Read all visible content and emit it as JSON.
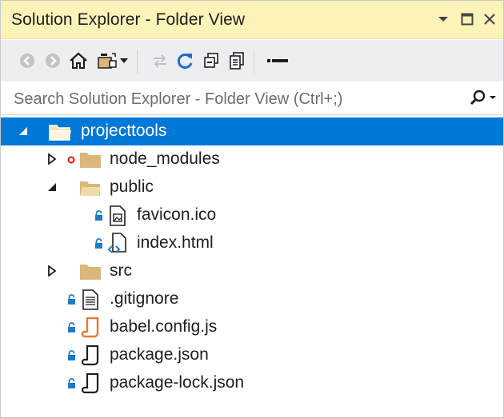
{
  "window": {
    "title": "Solution Explorer - Folder View"
  },
  "title_controls": [
    {
      "name": "window-position-dropdown",
      "icon": "chevron-down-icon"
    },
    {
      "name": "maximize-button",
      "icon": "maximize-icon"
    },
    {
      "name": "close-button",
      "icon": "close-icon"
    }
  ],
  "toolbar": {
    "buttons": [
      {
        "name": "back-button",
        "icon": "back-arrow-icon"
      },
      {
        "name": "forward-button",
        "icon": "forward-arrow-icon"
      },
      {
        "name": "home-button",
        "icon": "home-icon"
      },
      {
        "name": "switch-views-button",
        "icon": "switch-views-icon"
      },
      {
        "name": "switch-views-dropdown",
        "icon": "chevron-down-icon"
      },
      {
        "name": "sync-button",
        "icon": "sync-icon"
      },
      {
        "name": "refresh-button",
        "icon": "refresh-icon"
      },
      {
        "name": "collapse-all-button",
        "icon": "collapse-all-icon"
      },
      {
        "name": "show-all-files-button",
        "icon": "show-all-files-icon"
      },
      {
        "name": "properties-button",
        "icon": "properties-icon"
      }
    ]
  },
  "search": {
    "placeholder": "Search Solution Explorer - Folder View (Ctrl+;)"
  },
  "tree": {
    "items": [
      {
        "label": "projecttools",
        "type": "folder-open",
        "expanded": true,
        "selected": true
      },
      {
        "label": "node_modules",
        "type": "folder",
        "expanded": false,
        "status": "excluded"
      },
      {
        "label": "public",
        "type": "folder-open",
        "expanded": true
      },
      {
        "label": "favicon.ico",
        "type": "image-file",
        "status": "locked"
      },
      {
        "label": "index.html",
        "type": "html-file",
        "status": "locked"
      },
      {
        "label": "src",
        "type": "folder",
        "expanded": false
      },
      {
        "label": ".gitignore",
        "type": "text-file",
        "status": "locked"
      },
      {
        "label": "babel.config.js",
        "type": "js-file",
        "status": "locked"
      },
      {
        "label": "package.json",
        "type": "json-file",
        "status": "locked"
      },
      {
        "label": "package-lock.json",
        "type": "json-file",
        "status": "locked"
      }
    ]
  },
  "colors": {
    "title_bg": "#fcf3b9",
    "toolbar_bg": "#eeeef2",
    "selection": "#0078d7",
    "lock_badge": "#1e7bc9",
    "excluded_badge": "#e51400",
    "folder": "#dcb67a",
    "js_file": "#e37933"
  }
}
